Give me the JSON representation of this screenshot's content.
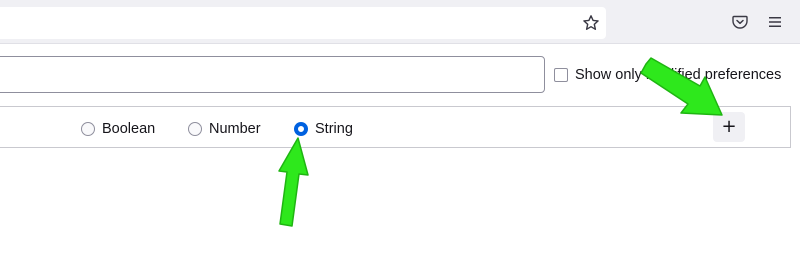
{
  "toolbar": {
    "bookmark_icon": "star-icon",
    "pocket_icon": "pocket-icon",
    "menu_icon": "hamburger-menu-icon"
  },
  "search": {
    "value": "",
    "placeholder": ""
  },
  "filter": {
    "show_modified_label": "Show only modified preferences",
    "checked": false
  },
  "new_pref": {
    "types": [
      {
        "label": "Boolean",
        "selected": false
      },
      {
        "label": "Number",
        "selected": false
      },
      {
        "label": "String",
        "selected": true
      }
    ],
    "add_label": "+"
  },
  "colors": {
    "accent": "#0061e0",
    "annotation_arrow": "#2ee81c"
  }
}
